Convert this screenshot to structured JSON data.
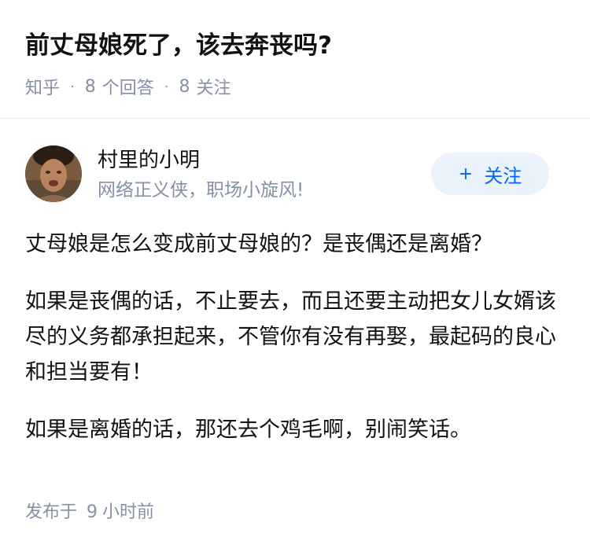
{
  "question": {
    "title": "前丈母娘死了，该去奔丧吗?",
    "source": "知乎",
    "separator": "·",
    "answer_count": "8",
    "answer_label": "个回答",
    "follower_count": "8",
    "follower_label": "关注"
  },
  "answer": {
    "author": {
      "name": "村里的小明",
      "bio": "网络正义侠，职场小旋风!",
      "follow_icon": "+",
      "follow_label": "关注"
    },
    "paragraphs": [
      "丈母娘是怎么变成前丈母娘的？是丧偶还是离婚？",
      "如果是丧偶的话，不止要去，而且还要主动把女儿女婿该尽的义务都承担起来，不管你有没有再娶，最起码的良心和担当要有！",
      "如果是离婚的话，那还去个鸡毛啊，别闹笑话。"
    ],
    "time_prefix": "发布于",
    "time_value": "9",
    "time_suffix": "小时前"
  },
  "colors": {
    "accent": "#0066ff",
    "meta": "#8590a6",
    "follow_bg": "#eaf2fb",
    "text": "#121212"
  }
}
